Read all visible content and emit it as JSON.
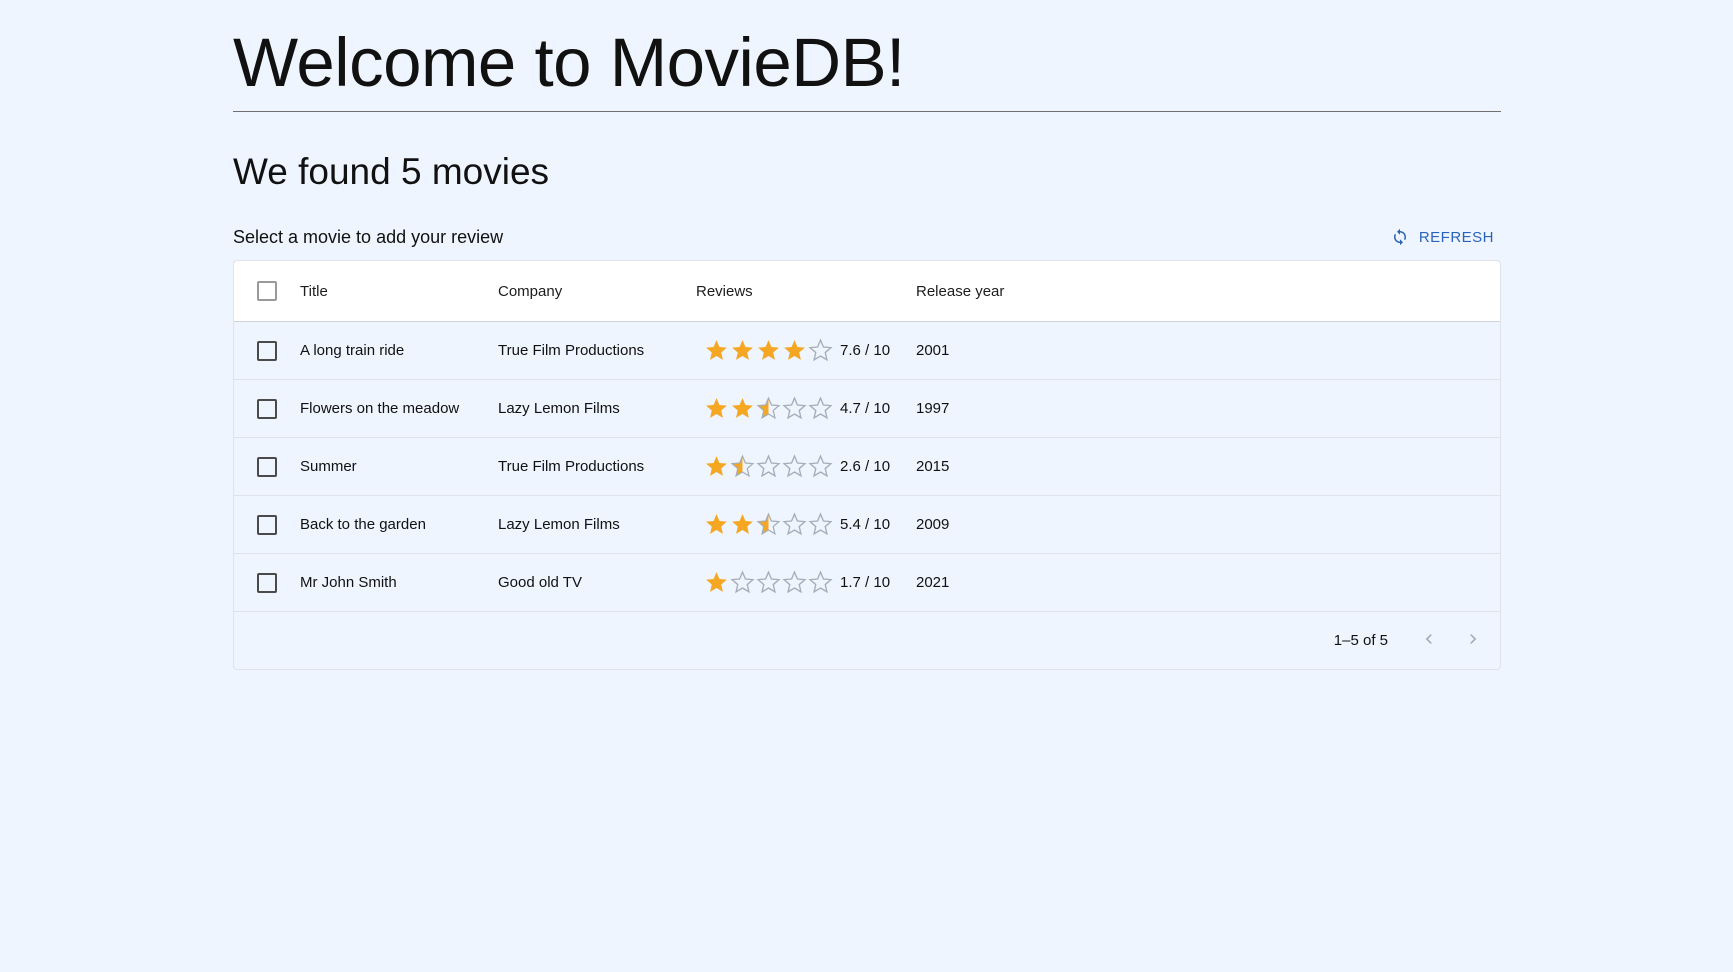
{
  "header": {
    "title": "Welcome to MovieDB!",
    "subtitle": "We found 5 movies"
  },
  "toolbar": {
    "instruction": "Select a movie to add your review",
    "refresh_label": "REFRESH",
    "refresh_icon": "refresh-icon"
  },
  "table": {
    "columns": {
      "title": "Title",
      "company": "Company",
      "reviews": "Reviews",
      "release_year": "Release year"
    },
    "rows": [
      {
        "title": "A long train ride",
        "company": "True Film Productions",
        "rating": 7.6,
        "rating_text": "7.6 / 10",
        "year": "2001"
      },
      {
        "title": "Flowers on the meadow",
        "company": "Lazy Lemon Films",
        "rating": 4.7,
        "rating_text": "4.7 / 10",
        "year": "1997"
      },
      {
        "title": "Summer",
        "company": "True Film Productions",
        "rating": 2.6,
        "rating_text": "2.6 / 10",
        "year": "2015"
      },
      {
        "title": "Back to the garden",
        "company": "Lazy Lemon Films",
        "rating": 5.4,
        "rating_text": "5.4 / 10",
        "year": "2009"
      },
      {
        "title": "Mr John Smith",
        "company": "Good old TV",
        "rating": 1.7,
        "rating_text": "1.7 / 10",
        "year": "2021"
      }
    ]
  },
  "pagination": {
    "info": "1–5 of 5",
    "prev_icon": "chevron-left-icon",
    "next_icon": "chevron-right-icon"
  },
  "colors": {
    "background": "#eef5ff",
    "accent": "#2a64b8",
    "star_filled": "#f5a623",
    "star_empty": "#a7adb5"
  }
}
